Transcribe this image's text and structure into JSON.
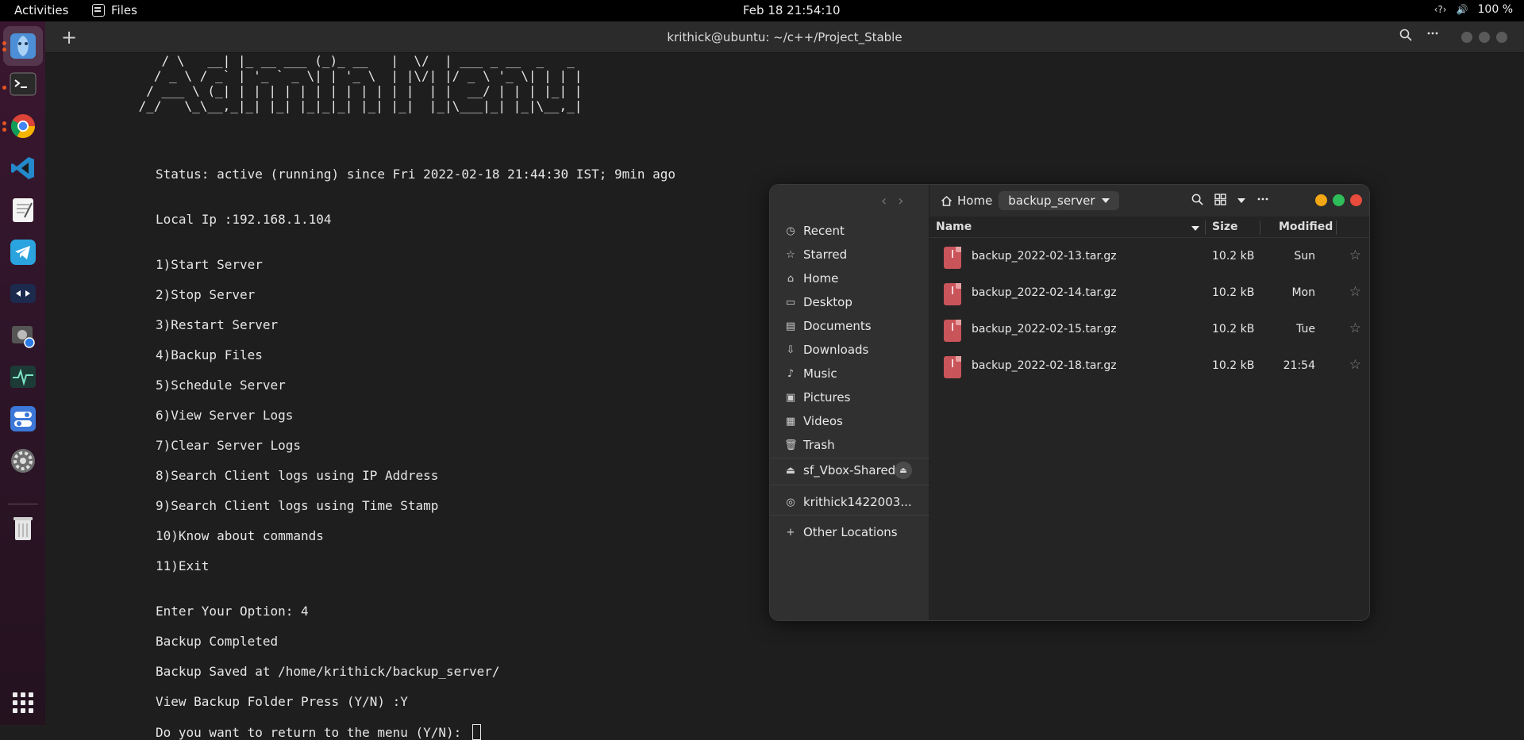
{
  "topbar": {
    "activities": "Activities",
    "app_name": "Files",
    "clock": "Feb 18  21:54:10",
    "tray_network": "‹?›",
    "tray_volume": "🔊",
    "battery": "100 %"
  },
  "dock": {
    "items": [
      "files-app",
      "terminal-app",
      "chrome-app",
      "vscode-app",
      "text-editor-app",
      "telegram-app",
      "remote-desktop-app",
      "screenshot-app",
      "system-monitor-app",
      "settings-toggle-app",
      "settings-app",
      "trash-app",
      "show-apps"
    ]
  },
  "terminal": {
    "title": "krithick@ubuntu: ~/c++/Project_Stable",
    "new_tab": "+",
    "ascii_art": "    / \\   __| |_ __ ___ (_)_ __   |  \\/  | ___ _ __  _   _\n   / _ \\ / _` | '_ ` _ \\| | '_ \\  | |\\/| |/ _ \\ '_ \\| | | |\n  / ___ \\ (_| | | | | | | | | | | | |  | |  __/ | | | |_| |\n /_/   \\_\\__,_|_| |_| |_|_|_| |_| |_|  |_|\\___|_| |_|\\__,_|",
    "lines": [
      "Status: active (running) since Fri 2022-02-18 21:44:30 IST; 9min ago",
      "Local Ip :192.168.1.104",
      "1)Start Server",
      "2)Stop Server",
      "3)Restart Server",
      "4)Backup Files",
      "5)Schedule Server",
      "6)View Server Logs",
      "7)Clear Server Logs",
      "8)Search Client logs using IP Address",
      "9)Search Client logs using Time Stamp",
      "10)Know about commands",
      "11)Exit",
      "Enter Your Option: 4",
      "Backup Completed",
      "Backup Saved at /home/krithick/backup_server/",
      "View Backup Folder Press (Y/N) :Y",
      "Do you want to return to the menu (Y/N): "
    ]
  },
  "files": {
    "crumb_home": "Home",
    "crumb_current": "backup_server",
    "sidebar": [
      {
        "icon": "clock-icon",
        "glyph": "◷",
        "label": "Recent"
      },
      {
        "icon": "star-icon",
        "glyph": "☆",
        "label": "Starred"
      },
      {
        "icon": "home-icon",
        "glyph": "⌂",
        "label": "Home"
      },
      {
        "icon": "desktop-icon",
        "glyph": "▭",
        "label": "Desktop"
      },
      {
        "icon": "documents-icon",
        "glyph": "▤",
        "label": "Documents"
      },
      {
        "icon": "downloads-icon",
        "glyph": "⇩",
        "label": "Downloads"
      },
      {
        "icon": "music-icon",
        "glyph": "♪",
        "label": "Music"
      },
      {
        "icon": "pictures-icon",
        "glyph": "▣",
        "label": "Pictures"
      },
      {
        "icon": "videos-icon",
        "glyph": "▦",
        "label": "Videos"
      },
      {
        "icon": "trash-icon",
        "glyph": "🗑",
        "label": "Trash"
      },
      {
        "icon": "drive-icon",
        "glyph": "⏏",
        "label": "sf_Vbox-Shared"
      },
      {
        "icon": "network-icon",
        "glyph": "◎",
        "label": "krithick1422003..."
      },
      {
        "icon": "plus-icon",
        "glyph": "+",
        "label": "Other Locations"
      }
    ],
    "columns": {
      "name": "Name",
      "size": "Size",
      "modified": "Modified"
    },
    "rows": [
      {
        "name": "backup_2022-02-13.tar.gz",
        "size": "10.2 kB",
        "modified": "Sun"
      },
      {
        "name": "backup_2022-02-14.tar.gz",
        "size": "10.2 kB",
        "modified": "Mon"
      },
      {
        "name": "backup_2022-02-15.tar.gz",
        "size": "10.2 kB",
        "modified": "Tue"
      },
      {
        "name": "backup_2022-02-18.tar.gz",
        "size": "10.2 kB",
        "modified": "21:54"
      }
    ]
  },
  "colors": {
    "accent": "#e95420",
    "close": "#e74c3c",
    "minimize": "#f3a712",
    "maximize": "#2ebd59"
  }
}
